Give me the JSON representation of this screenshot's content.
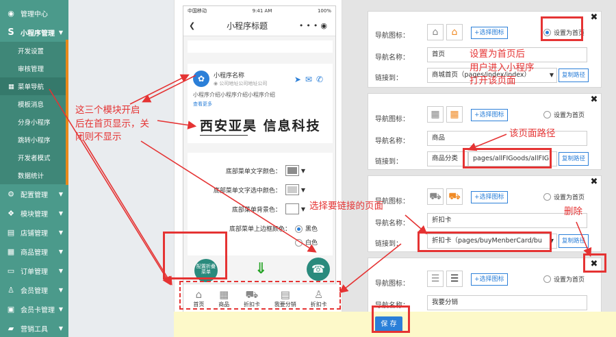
{
  "sidebar": {
    "items": [
      {
        "icon": "dashboard-icon",
        "glyph": "◉",
        "label": "管理中心"
      },
      {
        "icon": "miniapp-icon",
        "glyph": "S",
        "label": "小程序管理"
      }
    ],
    "subitems": [
      {
        "label": "开发设置"
      },
      {
        "label": "审核管理"
      },
      {
        "label": "菜单导航"
      },
      {
        "label": "模板消息"
      },
      {
        "label": "分身小程序"
      },
      {
        "label": "跳转小程序"
      },
      {
        "label": "开发者模式"
      },
      {
        "label": "数据统计"
      }
    ],
    "groups": [
      {
        "icon": "gears-icon",
        "glyph": "⚙",
        "label": "配置管理"
      },
      {
        "icon": "cubes-icon",
        "glyph": "❖",
        "label": "模块管理"
      },
      {
        "icon": "bank-icon",
        "glyph": "▤",
        "label": "店铺管理"
      },
      {
        "icon": "goods-icon",
        "glyph": "▦",
        "label": "商品管理"
      },
      {
        "icon": "order-icon",
        "glyph": "▭",
        "label": "订单管理"
      },
      {
        "icon": "user-icon",
        "glyph": "♙",
        "label": "会员管理"
      },
      {
        "icon": "card-icon",
        "glyph": "▣",
        "label": "会员卡管理"
      },
      {
        "icon": "briefcase-icon",
        "glyph": "▰",
        "label": "营销工具"
      }
    ]
  },
  "phone": {
    "carrier": "中国移动",
    "time": "9:41 AM",
    "battery": "100%",
    "title": "小程序标题",
    "shop_name": "小程序名称",
    "shop_address": "公司地址公司地址公司",
    "shop_intro": "小程序介绍小程序介绍小程序介绍",
    "more": "查看更多",
    "banner_text": "西安亚昊 信息科技",
    "color_rows": [
      {
        "label": "底部菜单文字颜色：",
        "color": "#8c8c8c"
      },
      {
        "label": "底部菜单文字选中颜色：",
        "color": "#cccccc"
      },
      {
        "label": "底部菜单背景色：",
        "color": "#ffffff"
      }
    ],
    "border_label": "底部菜单上边框颜色：",
    "border_options": [
      "黑色",
      "白色"
    ],
    "fab_menu": "配置折叠菜单",
    "tabs": [
      {
        "icon": "home-icon",
        "glyph": "⌂",
        "label": "首页"
      },
      {
        "icon": "grid-icon",
        "glyph": "▦",
        "label": "商品"
      },
      {
        "icon": "cart-icon",
        "glyph": "⛟",
        "label": "折扣卡"
      },
      {
        "icon": "share-icon",
        "glyph": "▤",
        "label": "我要分销"
      },
      {
        "icon": "person-icon",
        "glyph": "♙",
        "label": "折扣卡"
      }
    ]
  },
  "editor": {
    "icon_label": "导航图标：",
    "name_label": "导航名称：",
    "link_label": "链接到：",
    "pick_icon": "+选择图标",
    "set_home": "设置为首页",
    "copy_path": "复制路径",
    "navs": [
      {
        "glyph_a": "⌂",
        "glyph_b": "⌂",
        "name": "首页",
        "link": "商城首页（pages/index/index）",
        "home": true
      },
      {
        "glyph_a": "▦",
        "glyph_b": "▦",
        "name": "商品",
        "link": "商品分类",
        "path": "pages/allFIGoods/allFIG",
        "home": false
      },
      {
        "glyph_a": "⛟",
        "glyph_b": "⛟",
        "name": "折扣卡",
        "link": "折扣卡（pages/buyMenberCard/bu",
        "home": false
      },
      {
        "glyph_a": "☰",
        "glyph_b": "☰",
        "name": "我要分销",
        "home": false
      }
    ]
  },
  "save_label": "保 存",
  "annotations": {
    "modules": "这三个模块开启\n后在首页显示，关\n闭则不显示",
    "set_home": "设置为首页后\n用户进入小程序\n打开该页面",
    "page_path": "该页面路径",
    "choose_link": "选择要链接的页面",
    "delete": "删除"
  },
  "colors": {
    "sidebar": "#4b9a8b",
    "accent_blue": "#2b7fd8",
    "annotation_red": "#e53333"
  }
}
